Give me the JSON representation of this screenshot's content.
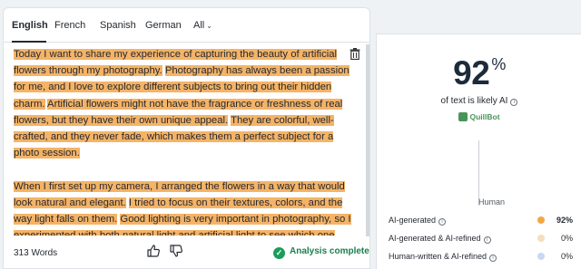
{
  "tabs": [
    {
      "label": "English"
    },
    {
      "label": "French"
    },
    {
      "label": "Spanish"
    },
    {
      "label": "German"
    },
    {
      "label": "All"
    }
  ],
  "editor": {
    "paragraphs": [
      [
        {
          "text": "Today I want to share my experience of capturing the beauty of artificial flowers through my photography.",
          "highlight": true
        },
        {
          "text": " ",
          "highlight": false
        },
        {
          "text": "Photography has always been a passion for me, and I love to explore different subjects to bring out their hidden charm.",
          "highlight": true
        },
        {
          "text": " ",
          "highlight": false
        },
        {
          "text": "Artificial flowers might not have the fragrance or freshness of real flowers, but they have their own unique appeal.",
          "highlight": true
        },
        {
          "text": " ",
          "highlight": false
        },
        {
          "text": "They are colorful, well-crafted, and they never fade, which makes them a perfect subject for a photo session.",
          "highlight": true
        }
      ],
      [
        {
          "text": "When I first set up my camera, I arranged the flowers in a way that would look natural and elegant.",
          "highlight": true
        },
        {
          "text": " ",
          "highlight": false
        },
        {
          "text": "I tried to focus on their textures, colors, and the way light falls on them.",
          "highlight": true
        },
        {
          "text": " ",
          "highlight": false
        },
        {
          "text": "Good lighting is very important in photography, so I experimented with both natural light and artificial light to see which one worked best.",
          "highlight": true
        }
      ]
    ]
  },
  "footer": {
    "word_count": "313 Words",
    "status": "Analysis complete"
  },
  "results": {
    "score_value": "92",
    "score_unit": "%",
    "score_label": "of text is likely AI",
    "brand": "QuillBot",
    "bar_label": "Human",
    "legend": [
      {
        "label": "AI-generated",
        "value": "92%",
        "color": "#f5a546"
      },
      {
        "label": "AI-generated & AI-refined",
        "value": "0%",
        "color": "#f7dcc0"
      },
      {
        "label": "Human-written & AI-refined",
        "value": "0%",
        "color": "#c8d8f2"
      }
    ]
  }
}
